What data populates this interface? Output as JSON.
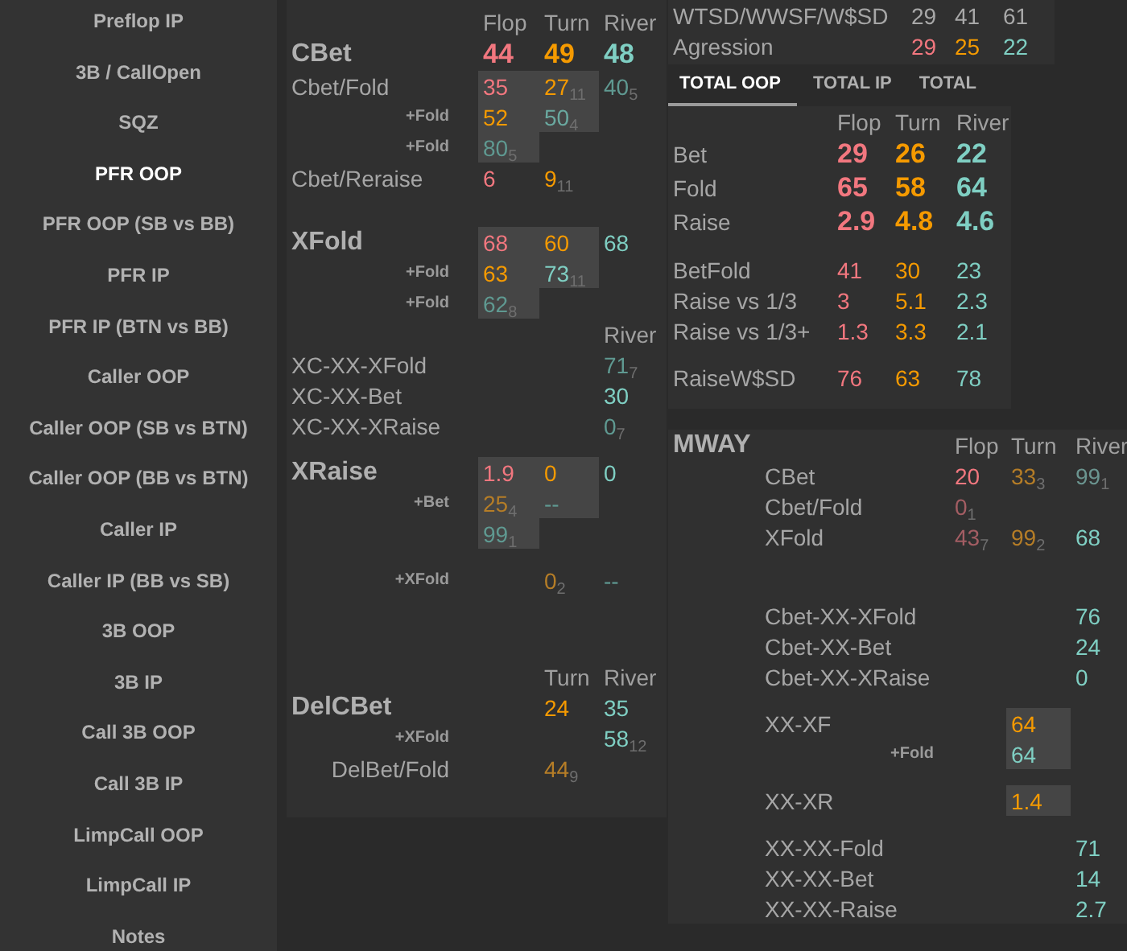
{
  "sidebar": {
    "items": [
      {
        "label": "Preflop IP",
        "selected": false
      },
      {
        "label": "3B / CallOpen",
        "selected": false
      },
      {
        "label": "SQZ",
        "selected": false
      },
      {
        "label": "PFR OOP",
        "selected": true
      },
      {
        "label": "PFR OOP (SB vs BB)",
        "selected": false
      },
      {
        "label": "PFR IP",
        "selected": false
      },
      {
        "label": "PFR IP (BTN vs BB)",
        "selected": false
      },
      {
        "label": "Caller OOP",
        "selected": false
      },
      {
        "label": "Caller OOP (SB vs BTN)",
        "selected": false
      },
      {
        "label": "Caller OOP (BB vs BTN)",
        "selected": false
      },
      {
        "label": "Caller IP",
        "selected": false
      },
      {
        "label": "Caller IP (BB vs SB)",
        "selected": false
      },
      {
        "label": "3B OOP",
        "selected": false
      },
      {
        "label": "3B IP",
        "selected": false
      },
      {
        "label": "Call 3B OOP",
        "selected": false
      },
      {
        "label": "Call 3B IP",
        "selected": false
      },
      {
        "label": "LimpCall OOP",
        "selected": false
      },
      {
        "label": "LimpCall IP",
        "selected": false
      },
      {
        "label": "Notes",
        "selected": false
      }
    ]
  },
  "main_panel": {
    "sections": [
      {
        "rows": [
          {
            "kind": "header",
            "cells": [
              "Flop",
              "Turn",
              "River"
            ]
          },
          {
            "kind": "head",
            "label": "CBet",
            "strong": true,
            "cells": [
              {
                "text": "44",
                "color": "#f2777f",
                "shaded": false
              },
              {
                "text": "49",
                "color": "#f59a00",
                "shaded": false
              },
              {
                "text": "48",
                "color": "#7fcfc3",
                "shaded": false
              }
            ]
          },
          {
            "kind": "row",
            "label": "Cbet/Fold",
            "cells": [
              {
                "text": "35",
                "color": "#f2777f",
                "shaded": true
              },
              {
                "text": "27$_{11}$",
                "color": "#f59a00",
                "shaded": true
              },
              {
                "text": "40$_{5}$",
                "color": "#5f9991",
                "shaded": false
              }
            ]
          },
          {
            "kind": "plus",
            "label": "+Fold",
            "cells": [
              {
                "text": "52",
                "color": "#f59a00",
                "shaded": true
              },
              {
                "text": "50$_{4}$",
                "color": "#6aa9a0",
                "shaded": true
              },
              null
            ]
          },
          {
            "kind": "plus",
            "label": "+Fold",
            "cells": [
              {
                "text": "80$_{5}$",
                "color": "#5f9991",
                "shaded": true
              },
              null,
              null
            ]
          },
          {
            "kind": "row",
            "label": "Cbet/Reraise",
            "cells": [
              {
                "text": "6",
                "color": "#f2777f",
                "shaded": false
              },
              {
                "text": "9$_{11}$",
                "color": "#f59a00",
                "shaded": false
              },
              null
            ]
          }
        ]
      },
      {
        "rows": [
          {
            "kind": "head",
            "label": "XFold",
            "cells": [
              {
                "text": "68",
                "color": "#f2777f",
                "shaded": true
              },
              {
                "text": "60",
                "color": "#f59a00",
                "shaded": true
              },
              {
                "text": "68",
                "color": "#7fcfc3",
                "shaded": false
              }
            ]
          },
          {
            "kind": "plus",
            "label": "+Fold",
            "cells": [
              {
                "text": "63",
                "color": "#f59a00",
                "shaded": true
              },
              {
                "text": "73$_{11}$",
                "color": "#7fcfc3",
                "shaded": true
              },
              null
            ]
          },
          {
            "kind": "plus",
            "label": "+Fold",
            "cells": [
              {
                "text": "62$_{8}$",
                "color": "#5f9991",
                "shaded": true
              },
              null,
              null
            ]
          },
          {
            "kind": "header",
            "cells": [
              null,
              null,
              "River"
            ]
          },
          {
            "kind": "row",
            "label": "XC-XX-XFold",
            "cells": [
              null,
              null,
              {
                "text": "71$_{7}$",
                "color": "#5f9991",
                "shaded": false
              }
            ]
          },
          {
            "kind": "row",
            "label": "XC-XX-Bet",
            "cells": [
              null,
              null,
              {
                "text": "30",
                "color": "#7fcfc3",
                "shaded": false
              }
            ]
          },
          {
            "kind": "row",
            "label": "XC-XX-XRaise",
            "cells": [
              null,
              null,
              {
                "text": "0$_{7}$",
                "color": "#5f9991",
                "shaded": false
              }
            ]
          }
        ]
      },
      {
        "rows": [
          {
            "kind": "head",
            "label": "XRaise",
            "cells": [
              {
                "text": "1.9",
                "color": "#f2777f",
                "shaded": true
              },
              {
                "text": "0",
                "color": "#f59a00",
                "shaded": true
              },
              {
                "text": "0",
                "color": "#7fcfc3",
                "shaded": false
              }
            ]
          },
          {
            "kind": "plus",
            "label": "+Bet",
            "cells": [
              {
                "text": "25$_{4}$",
                "color": "#b57d27",
                "shaded": true
              },
              {
                "text": "--",
                "color": "#5f9991",
                "shaded": true
              },
              null
            ]
          },
          {
            "kind": "row",
            "cells": [
              {
                "text": "99$_{1}$",
                "color": "#5f9991",
                "shaded": true
              },
              null,
              null
            ]
          }
        ]
      },
      {
        "rows": [
          {
            "kind": "plus",
            "label": "+XFold",
            "cells": [
              null,
              {
                "text": "0$_{2}$",
                "color": "#b57d27",
                "shaded": false
              },
              {
                "text": "--",
                "color": "#5f9991",
                "shaded": false
              }
            ]
          }
        ]
      },
      {
        "rows": [
          {
            "kind": "header",
            "cells": [
              null,
              "Turn",
              "River"
            ]
          },
          {
            "kind": "head",
            "label": "DelCBet",
            "cells": [
              null,
              {
                "text": "24",
                "color": "#f59a00",
                "shaded": false
              },
              {
                "text": "35",
                "color": "#7fcfc3",
                "shaded": false
              }
            ]
          },
          {
            "kind": "plus",
            "label": "+XFold",
            "cells": [
              null,
              null,
              {
                "text": "58$_{12}$",
                "color": "#7fcfc3",
                "shaded": false
              }
            ]
          },
          {
            "kind": "right",
            "label": "DelBet/Fold",
            "cells": [
              null,
              {
                "text": "44$_{9}$",
                "color": "#b57d27",
                "shaded": false
              },
              null
            ]
          }
        ]
      }
    ]
  },
  "summary_panel": {
    "sections": [
      {
        "rows": [
          {
            "kind": "row",
            "label": "WTSD/WWSF/W$SD",
            "cells": [
              {
                "text": "29",
                "color": "#a8a8a8",
                "shaded": false
              },
              {
                "text": "41",
                "color": "#a8a8a8",
                "shaded": false
              },
              {
                "text": "61",
                "color": "#a8a8a8",
                "shaded": false
              }
            ]
          },
          {
            "kind": "row",
            "label": "Agression",
            "cells": [
              {
                "text": "29",
                "color": "#f2777f",
                "shaded": false
              },
              {
                "text": "25",
                "color": "#f59a00",
                "shaded": false
              },
              {
                "text": "22",
                "color": "#7fcfc3",
                "shaded": false
              }
            ]
          }
        ]
      }
    ]
  },
  "tabs": [
    {
      "label": "TOTAL OOP",
      "selected": true
    },
    {
      "label": "TOTAL IP",
      "selected": false
    },
    {
      "label": "TOTAL",
      "selected": false
    }
  ],
  "total_panel": {
    "sections": [
      {
        "rows": [
          {
            "kind": "header",
            "cells": [
              "Flop",
              "Turn",
              "River"
            ]
          },
          {
            "kind": "row",
            "label": "Bet",
            "strong": true,
            "cells": [
              {
                "text": "29",
                "color": "#f2777f",
                "shaded": false
              },
              {
                "text": "26",
                "color": "#f59a00",
                "shaded": false
              },
              {
                "text": "22",
                "color": "#7fcfc3",
                "shaded": false
              }
            ]
          },
          {
            "kind": "row",
            "label": "Fold",
            "strong": true,
            "cells": [
              {
                "text": "65",
                "color": "#f2777f",
                "shaded": false
              },
              {
                "text": "58",
                "color": "#f59a00",
                "shaded": false
              },
              {
                "text": "64",
                "color": "#7fcfc3",
                "shaded": false
              }
            ]
          },
          {
            "kind": "row",
            "label": "Raise",
            "strong": true,
            "cells": [
              {
                "text": "2.9",
                "color": "#f2777f",
                "shaded": false
              },
              {
                "text": "4.8",
                "color": "#f59a00",
                "shaded": false
              },
              {
                "text": "4.6",
                "color": "#7fcfc3",
                "shaded": false
              }
            ]
          }
        ]
      },
      {
        "rows": [
          {
            "kind": "row",
            "label": "BetFold",
            "cells": [
              {
                "text": "41",
                "color": "#f2777f",
                "shaded": false
              },
              {
                "text": "30",
                "color": "#f59a00",
                "shaded": false
              },
              {
                "text": "23",
                "color": "#7fcfc3",
                "shaded": false
              }
            ]
          },
          {
            "kind": "row",
            "label": "Raise vs 1/3",
            "cells": [
              {
                "text": "3",
                "color": "#f2777f",
                "shaded": false
              },
              {
                "text": "5.1",
                "color": "#f59a00",
                "shaded": false
              },
              {
                "text": "2.3",
                "color": "#7fcfc3",
                "shaded": false
              }
            ]
          },
          {
            "kind": "row",
            "label": "Raise vs 1/3+",
            "cells": [
              {
                "text": "1.3",
                "color": "#f2777f",
                "shaded": false
              },
              {
                "text": "3.3",
                "color": "#f59a00",
                "shaded": false
              },
              {
                "text": "2.1",
                "color": "#7fcfc3",
                "shaded": false
              }
            ]
          }
        ]
      },
      {
        "rows": [
          {
            "kind": "row",
            "label": "RaiseW$SD",
            "cells": [
              {
                "text": "76",
                "color": "#f2777f",
                "shaded": false
              },
              {
                "text": "63",
                "color": "#f59a00",
                "shaded": false
              },
              {
                "text": "78",
                "color": "#7fcfc3",
                "shaded": false
              }
            ]
          }
        ]
      }
    ]
  },
  "mway_panel": {
    "sections": [
      {
        "rows": [
          {
            "kind": "title",
            "label": "MWAY",
            "cells": [
              "Flop",
              "Turn",
              "River"
            ]
          },
          {
            "kind": "row",
            "label": "CBet",
            "cells": [
              {
                "text": "20",
                "color": "#f2777f",
                "shaded": false
              },
              {
                "text": "33$_{3}$",
                "color": "#b57d27",
                "shaded": false
              },
              {
                "text": "99$_{1}$",
                "color": "#6b9590",
                "shaded": false
              }
            ]
          },
          {
            "kind": "row",
            "label": "Cbet/Fold",
            "cells": [
              {
                "text": "0$_{1}$",
                "color": "#a35d63",
                "shaded": false
              },
              null,
              null
            ]
          },
          {
            "kind": "row",
            "label": "XFold",
            "cells": [
              {
                "text": "43$_{7}$",
                "color": "#a35d63",
                "shaded": false
              },
              {
                "text": "99$_{2}$",
                "color": "#b57d27",
                "shaded": false
              },
              {
                "text": "68",
                "color": "#7fcfc3",
                "shaded": false
              }
            ]
          }
        ]
      },
      {
        "rows": [
          {
            "kind": "row",
            "label": "Cbet-XX-XFold",
            "cells": [
              null,
              null,
              {
                "text": "76",
                "color": "#7fcfc3",
                "shaded": false
              }
            ]
          },
          {
            "kind": "row",
            "label": "Cbet-XX-Bet",
            "cells": [
              null,
              null,
              {
                "text": "24",
                "color": "#7fcfc3",
                "shaded": false
              }
            ]
          },
          {
            "kind": "row",
            "label": "Cbet-XX-XRaise",
            "cells": [
              null,
              null,
              {
                "text": "0",
                "color": "#7fcfc3",
                "shaded": false
              }
            ]
          }
        ]
      },
      {
        "rows": [
          {
            "kind": "row",
            "label": "XX-XF",
            "cells": [
              null,
              {
                "text": "64",
                "color": "#f59a00",
                "shaded": true
              },
              null
            ]
          },
          {
            "kind": "plus",
            "label": "+Fold",
            "cells": [
              null,
              {
                "text": "64",
                "color": "#7fcfc3",
                "shaded": true
              },
              null
            ]
          }
        ]
      },
      {
        "rows": [
          {
            "kind": "row",
            "label": "XX-XR",
            "cells": [
              null,
              {
                "text": "1.4",
                "color": "#f59a00",
                "shaded": true
              },
              null
            ]
          }
        ]
      },
      {
        "rows": [
          {
            "kind": "row",
            "label": "XX-XX-Fold",
            "cells": [
              null,
              null,
              {
                "text": "71",
                "color": "#7fcfc3",
                "shaded": false
              }
            ]
          },
          {
            "kind": "row",
            "label": "XX-XX-Bet",
            "cells": [
              null,
              null,
              {
                "text": "14",
                "color": "#7fcfc3",
                "shaded": false
              }
            ]
          },
          {
            "kind": "row",
            "label": "XX-XX-Raise",
            "cells": [
              null,
              null,
              {
                "text": "2.7",
                "color": "#7fcfc3",
                "shaded": false
              }
            ]
          }
        ]
      }
    ]
  }
}
